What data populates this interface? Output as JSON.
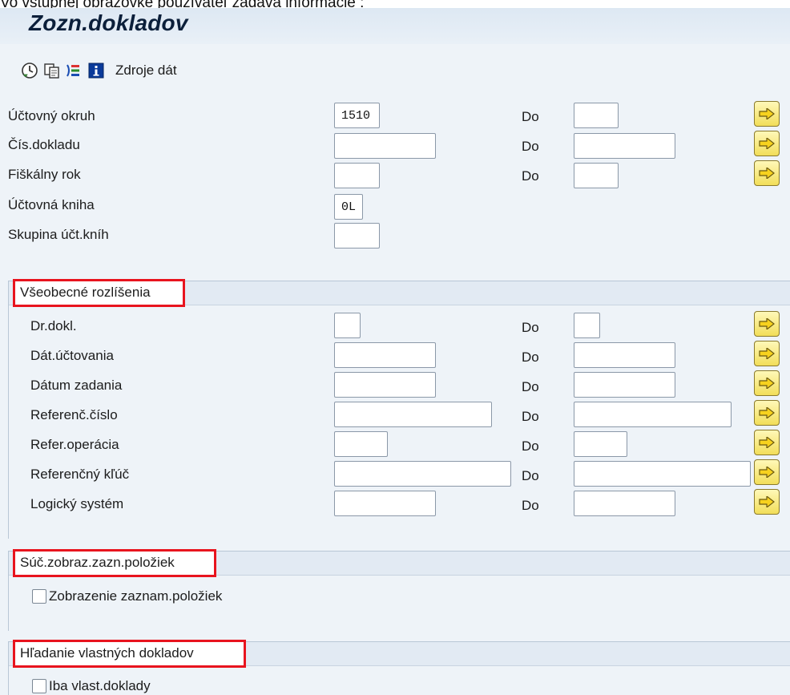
{
  "caption": "Vo vstupnej obrazovke používateľ zadáva informácie :",
  "window": {
    "title": "Zozn.dokladov"
  },
  "toolbar": {
    "icons": [
      "execute-clock-icon",
      "copy-variant-icon",
      "selection-options-icon",
      "info-icon"
    ],
    "data_sources_label": "Zdroje dát"
  },
  "header_fields": [
    {
      "label": "Účtovný okruh",
      "from_value": "1510",
      "to_label": "Do",
      "to_value": "",
      "multi": true
    },
    {
      "label": "Čís.dokladu",
      "from_value": "",
      "to_label": "Do",
      "to_value": "",
      "multi": true
    },
    {
      "label": "Fiškálny rok",
      "from_value": "",
      "to_label": "Do",
      "to_value": "",
      "multi": true
    },
    {
      "label": "Účtovná kniha",
      "from_value": "0L"
    },
    {
      "label": "Skupina účt.kníh",
      "from_value": ""
    }
  ],
  "general": {
    "title": "Všeobecné rozlíšenia",
    "fields": [
      {
        "label": "Dr.dokl.",
        "from_value": "",
        "to_label": "Do",
        "to_value": ""
      },
      {
        "label": "Dát.účtovania",
        "from_value": "",
        "to_label": "Do",
        "to_value": ""
      },
      {
        "label": "Dátum zadania",
        "from_value": "",
        "to_label": "Do",
        "to_value": ""
      },
      {
        "label": "Referenč.číslo",
        "from_value": "",
        "to_label": "Do",
        "to_value": ""
      },
      {
        "label": "Refer.operácia",
        "from_value": "",
        "to_label": "Do",
        "to_value": ""
      },
      {
        "label": "Referenčný kľúč",
        "from_value": "",
        "to_label": "Do",
        "to_value": ""
      },
      {
        "label": "Logický systém",
        "from_value": "",
        "to_label": "Do",
        "to_value": ""
      }
    ]
  },
  "entry_view": {
    "title": "Súč.zobraz.zazn.položiek",
    "checkbox_label": "Zobrazenie zaznam.položiek",
    "checked": false
  },
  "own_docs": {
    "title": "Hľadanie vlastných dokladov",
    "checkbox_label": "Iba vlast.doklady",
    "checked": false
  },
  "colors": {
    "highlight_border": "#e8141e",
    "multi_button": "#f2de59",
    "background": "#eef3f8"
  }
}
